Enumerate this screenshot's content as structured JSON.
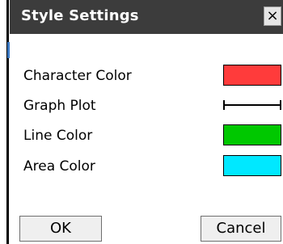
{
  "dialog": {
    "title": "Style Settings",
    "close_symbol": "×"
  },
  "settings": {
    "character_color": {
      "label": "Character Color",
      "color": "#ff3b3b"
    },
    "graph_plot": {
      "label": "Graph Plot",
      "style": "line-with-endpoints"
    },
    "line_color": {
      "label": "Line Color",
      "color": "#00c800"
    },
    "area_color": {
      "label": "Area Color",
      "color": "#00e8ff"
    }
  },
  "buttons": {
    "ok": "OK",
    "cancel": "Cancel"
  }
}
